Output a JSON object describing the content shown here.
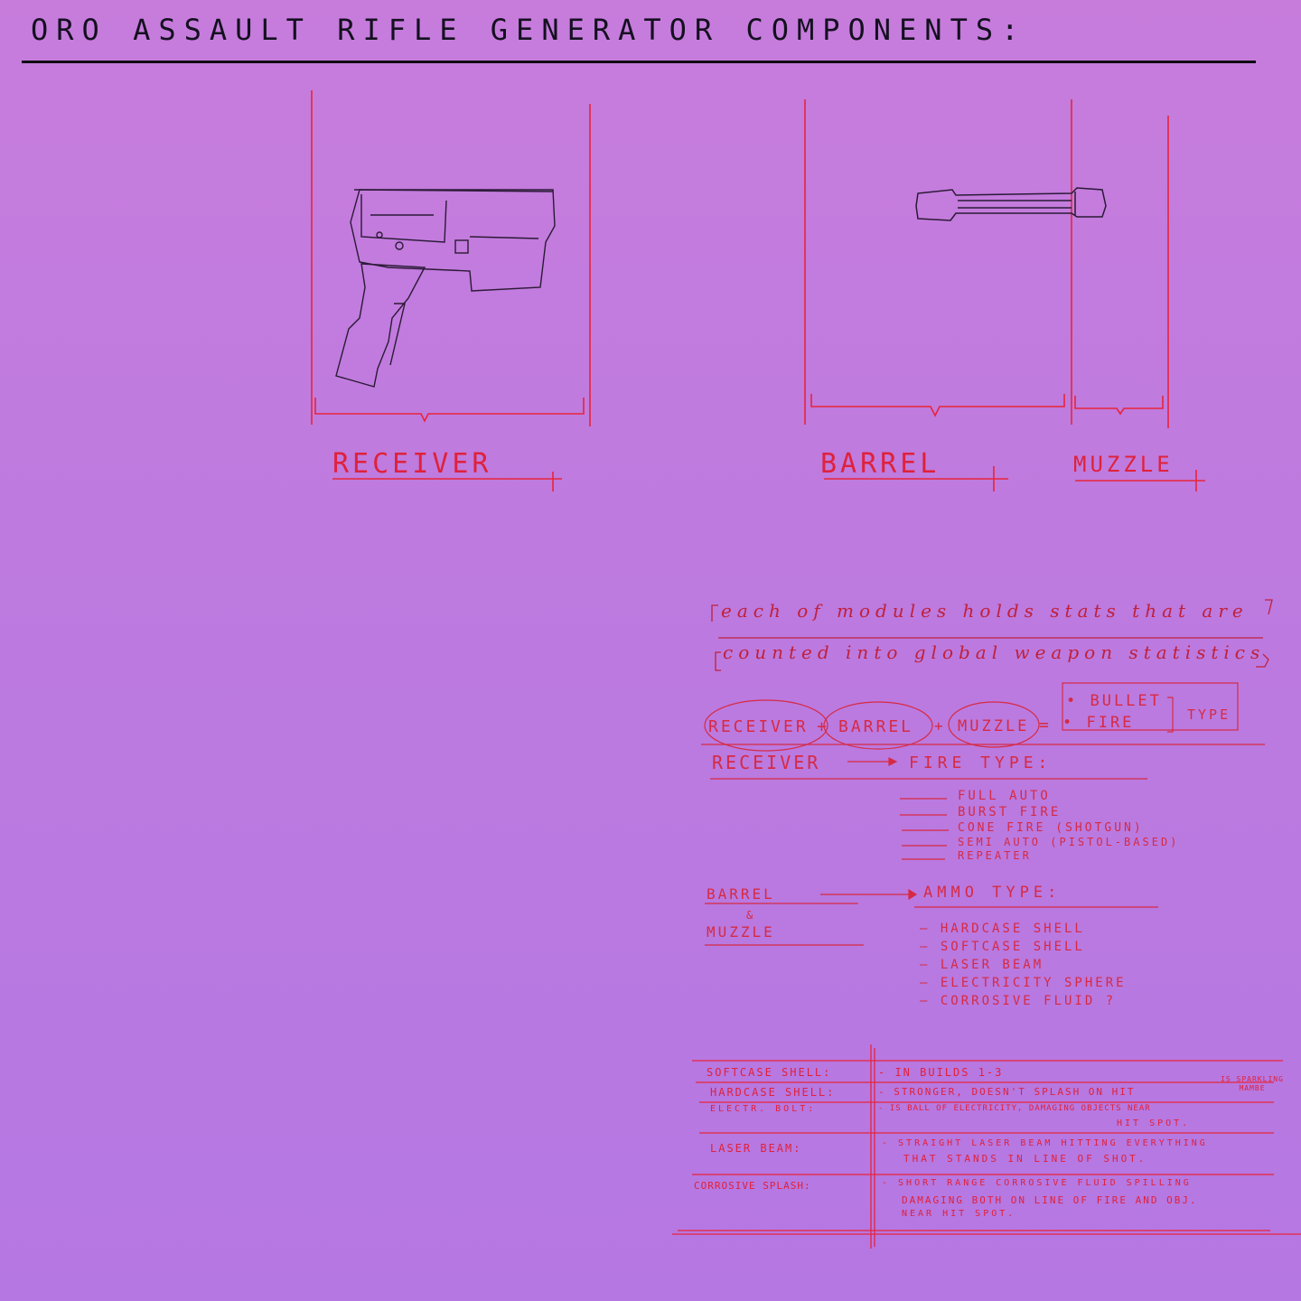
{
  "title": "ORO ASSAULT RIFLE GENERATOR COMPONENTS:",
  "components": {
    "receiver": "RECEIVER",
    "barrel": "BARREL",
    "muzzle": "MUZZLE"
  },
  "note": {
    "line1": "each of modules holds stats that are",
    "line2": "counted into global weapon statistics"
  },
  "formula": {
    "receiver": "RECEIVER",
    "barrel": "BARREL",
    "muzzle": "MUZZLE",
    "bullet": "• BULLET",
    "fire": "• FIRE",
    "type": "TYPE"
  },
  "receiver_section": {
    "label": "RECEIVER",
    "heading": "FIRE TYPE:",
    "items": [
      "FULL AUTO",
      "BURST FIRE",
      "CONE FIRE (SHOTGUN)",
      "SEMI AUTO (PISTOL-BASED)",
      "REPEATER"
    ]
  },
  "barrel_section": {
    "label1": "BARREL",
    "amp": "&",
    "label2": "MUZZLE",
    "heading": "AMMO TYPE:",
    "items": [
      "— HARDCASE SHELL",
      "— SOFTCASE SHELL",
      "— LASER BEAM",
      "— ELECTRICITY SPHERE",
      "— CORROSIVE FLUID ?"
    ]
  },
  "table": {
    "rows": [
      {
        "name": "SOFTCASE SHELL:",
        "desc": "- IN BUILDS 1-3"
      },
      {
        "name": "HARDCASE SHELL:",
        "desc": "- STRONGER, DOESN'T SPLASH ON HIT",
        "aside": "IS SPARKLING MAMBE"
      },
      {
        "name": "ELECTR. BOLT:",
        "desc": "- IS BALL OF ELECTRICITY, DAMAGING OBJECTS NEAR",
        "desc2": "HIT SPOT."
      },
      {
        "name": "LASER BEAM:",
        "desc": "- STRAIGHT LASER BEAM HITTING EVERYTHING",
        "desc2": "THAT STANDS IN LINE OF SHOT."
      },
      {
        "name": "CORROSIVE SPLASH:",
        "desc": "- SHORT RANGE CORROSIVE FLUID SPILLING",
        "desc2": "DAMAGING BOTH ON LINE OF FIRE AND OBJ.",
        "desc3": "NEAR HIT SPOT."
      }
    ]
  }
}
